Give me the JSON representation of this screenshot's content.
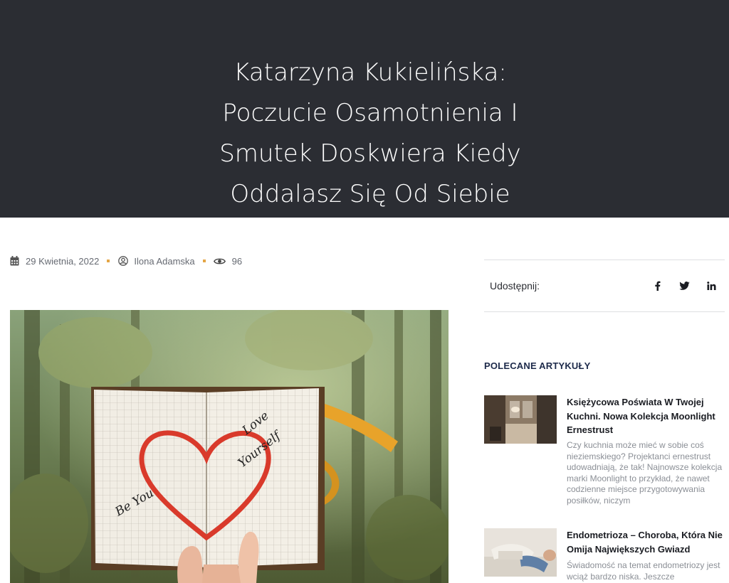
{
  "article": {
    "title_lines": [
      "Katarzyna Kukielińska:",
      "Poczucie Osamotnienia I",
      "Smutek Doskwiera Kiedy",
      "Oddalasz Się Od Siebie"
    ],
    "date": "29 Kwietnia, 2022",
    "author": "Ilona Adamska",
    "views": "96",
    "image_text": {
      "love": "Love",
      "yourself": "Yourself",
      "be_you": "Be You"
    }
  },
  "share": {
    "label": "Udostępnij:"
  },
  "featured": {
    "heading": "POLECANE ARTYKUŁY",
    "items": [
      {
        "title": "Księżycowa Poświata W Twojej Kuchni. Nowa Kolekcja Moonlight Ernestrust",
        "excerpt": "Czy kuchnia może mieć w sobie coś nieziemskiego? Projektanci ernestrust udowadniają, że tak! Najnowsze kolekcja marki Moonlight to przykład, że nawet codzienne miejsce przygotowywania posiłków, niczym"
      },
      {
        "title": "Endometrioza – Choroba, Która Nie Omija Największych Gwiazd",
        "excerpt": "Świadomość na temat endometriozy jest wciąż bardzo niska. Jeszcze"
      }
    ]
  },
  "colors": {
    "hero_bg": "#2b2d33",
    "accent": "#e4a646",
    "heading": "#1d2a4a"
  }
}
